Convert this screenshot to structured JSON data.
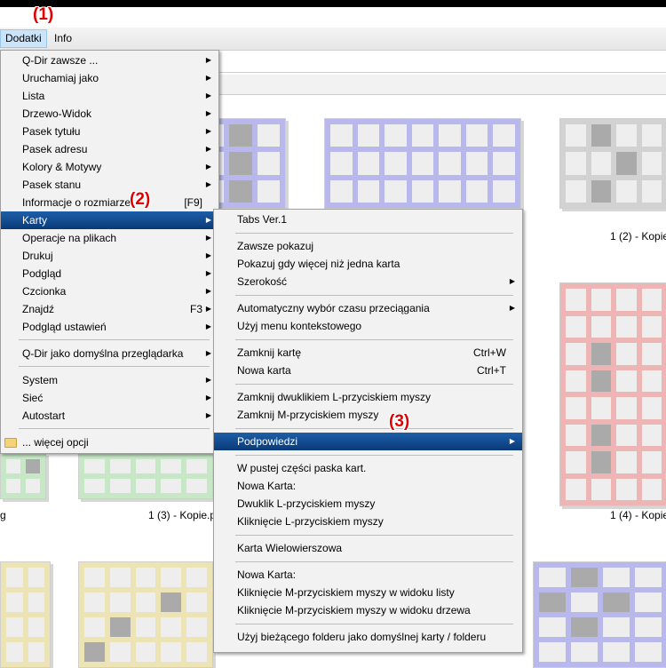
{
  "callouts": [
    "(1)",
    "(2)",
    "(3)"
  ],
  "menubar": {
    "dodatki": "Dodatki",
    "info": "Info"
  },
  "main_menu": [
    {
      "label": "Q-Dir zawsze ...",
      "arrow": true
    },
    {
      "label": "Uruchamiaj jako",
      "arrow": true
    },
    {
      "label": "Lista",
      "arrow": true
    },
    {
      "label": "Drzewo-Widok",
      "arrow": true
    },
    {
      "label": "Pasek tytułu",
      "arrow": true
    },
    {
      "label": "Pasek adresu",
      "arrow": true
    },
    {
      "label": "Kolory & Motywy",
      "arrow": true
    },
    {
      "label": "Pasek stanu",
      "arrow": true
    },
    {
      "label": "Informacje o rozmiarze",
      "shortcut": "[F9]",
      "arrow": false
    },
    {
      "label": "Karty",
      "arrow": true,
      "highlighted": true
    },
    {
      "label": "Operacje na plikach",
      "arrow": true
    },
    {
      "label": "Drukuj",
      "arrow": true
    },
    {
      "label": "Podgląd",
      "arrow": true
    },
    {
      "label": "Czcionka",
      "arrow": true
    },
    {
      "label": "Znajdź",
      "shortcut": "F3",
      "arrow": true
    },
    {
      "label": "Podgląd ustawień",
      "arrow": true
    },
    {
      "label": "Q-Dir jako domyślna przeglądarka",
      "arrow": true
    },
    {
      "label": "System",
      "arrow": true
    },
    {
      "label": "Sieć",
      "arrow": true
    },
    {
      "label": "Autostart",
      "arrow": true
    },
    {
      "label": "... więcej opcji",
      "arrow": false,
      "icon": "folder-icon"
    }
  ],
  "sub_menu": [
    {
      "label": "Tabs Ver.1"
    },
    {
      "label": "Zawsze pokazuj"
    },
    {
      "label": "Pokazuj gdy więcej niż jedna karta"
    },
    {
      "label": "Szerokość",
      "arrow": true
    },
    {
      "label": "Automatyczny wybór czasu przeciągania",
      "arrow": true
    },
    {
      "label": "Użyj menu kontekstowego"
    },
    {
      "label": "Zamknij kartę",
      "shortcut": "Ctrl+W"
    },
    {
      "label": "Nowa karta",
      "shortcut": "Ctrl+T"
    },
    {
      "label": "Zamknij dwuklikiem L-przyciskiem myszy"
    },
    {
      "label": "Zamknij M-przyciskiem myszy"
    },
    {
      "label": "Podpowiedzi",
      "arrow": true,
      "highlighted": true
    },
    {
      "label": "W pustej części paska kart."
    },
    {
      "label": "Nowa Karta:"
    },
    {
      "label": "Dwuklik L-przyciskiem myszy"
    },
    {
      "label": "Kliknięcie L-przyciskiem myszy"
    },
    {
      "label": "Karta Wielowierszowa"
    },
    {
      "label": "Nowa Karta:"
    },
    {
      "label": "Kliknięcie M-przyciskiem myszy w widoku listy"
    },
    {
      "label": "Kliknięcie M-przyciskiem myszy w widoku drzewa"
    },
    {
      "label": "Użyj bieżącego folderu jako domyślnej karty / folderu"
    }
  ],
  "captions": [
    "1 (2) - Kopie",
    "g",
    "1 (3) - Kopie.p",
    "1 (4) - Kopie"
  ],
  "colors": {
    "blue": "#b8b8ec",
    "gray": "#d2d2d2",
    "red": "#eeb5b5",
    "green": "#c6e8c6",
    "yellow": "#ece4b4",
    "highlight": "#0a4a92"
  }
}
